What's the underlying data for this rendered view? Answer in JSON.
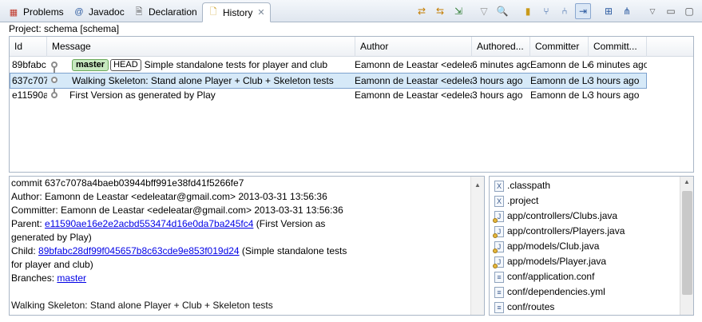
{
  "tabs": [
    {
      "label": "Problems",
      "icon": "problems-icon",
      "active": false
    },
    {
      "label": "Javadoc",
      "icon": "javadoc-icon",
      "active": false
    },
    {
      "label": "Declaration",
      "icon": "declaration-icon",
      "active": false
    },
    {
      "label": "History",
      "icon": "history-icon",
      "active": true,
      "close": "✕"
    }
  ],
  "toolbar_icons": [
    "sync-icon",
    "compare-icon",
    "link-icon",
    "filter-icon",
    "search-icon",
    "repository-icon",
    "show-all-branches-icon",
    "show-all-icon",
    "compare-mode-icon",
    "switch-icon",
    "view-menu-icon",
    "minimize-icon",
    "maximize-icon"
  ],
  "project_label": "Project: schema [schema]",
  "table": {
    "columns": [
      "Id",
      "Message",
      "Author",
      "Authored...",
      "Committer",
      "Committ..."
    ],
    "rows": [
      {
        "id": "89bfabc",
        "ref_master": "master",
        "ref_head": "HEAD",
        "message": "Simple standalone tests for player and club",
        "author": "Eamonn de Leastar <edelea",
        "authored": "6 minutes ago",
        "committer": "Eamonn de Le",
        "committed": "6 minutes ago"
      },
      {
        "id": "637c707",
        "message": "Walking Skeleton: Stand alone Player + Club + Skeleton tests",
        "author": "Eamonn de Leastar <edelea",
        "authored": "3 hours ago",
        "committer": "Eamonn de Le",
        "committed": "3 hours ago"
      },
      {
        "id": "e11590a",
        "message": "First Version as generated by Play",
        "author": "Eamonn de Leastar <edelea",
        "authored": "3 hours ago",
        "committer": "Eamonn de Le",
        "committed": "3 hours ago"
      }
    ]
  },
  "detail": {
    "commit": "commit 637c7078a4baeb03944bff991e38fd41f5266fe7",
    "author": "Author: Eamonn de Leastar <edeleatar@gmail.com> 2013-03-31 13:56:36",
    "committer": "Committer: Eamonn de Leastar <edeleatar@gmail.com> 2013-03-31 13:56:36",
    "parent_label": "Parent: ",
    "parent_hash": "e11590ae16e2e2acbd553474d16e0da7ba245fc4",
    "parent_msg_1": " (First Version as",
    "parent_msg_2": "generated by Play)",
    "child_label": "Child: ",
    "child_hash": "89bfabc28df99f045657b8c63cde9e853f019d24",
    "child_msg_1": " (Simple standalone tests",
    "child_msg_2": "for player and club)",
    "branches_label": "Branches: ",
    "branches_value": "master",
    "message": "Walking Skeleton: Stand alone Player + Club + Skeleton tests"
  },
  "files": [
    {
      "name": ".classpath",
      "icon": "xml-file-icon"
    },
    {
      "name": ".project",
      "icon": "xml-file-icon"
    },
    {
      "name": "app/controllers/Clubs.java",
      "icon": "java-file-icon"
    },
    {
      "name": "app/controllers/Players.java",
      "icon": "java-file-icon"
    },
    {
      "name": "app/models/Club.java",
      "icon": "java-file-icon"
    },
    {
      "name": "app/models/Player.java",
      "icon": "java-file-icon"
    },
    {
      "name": "conf/application.conf",
      "icon": "text-file-icon"
    },
    {
      "name": "conf/dependencies.yml",
      "icon": "text-file-icon"
    },
    {
      "name": "conf/routes",
      "icon": "text-file-icon"
    }
  ]
}
